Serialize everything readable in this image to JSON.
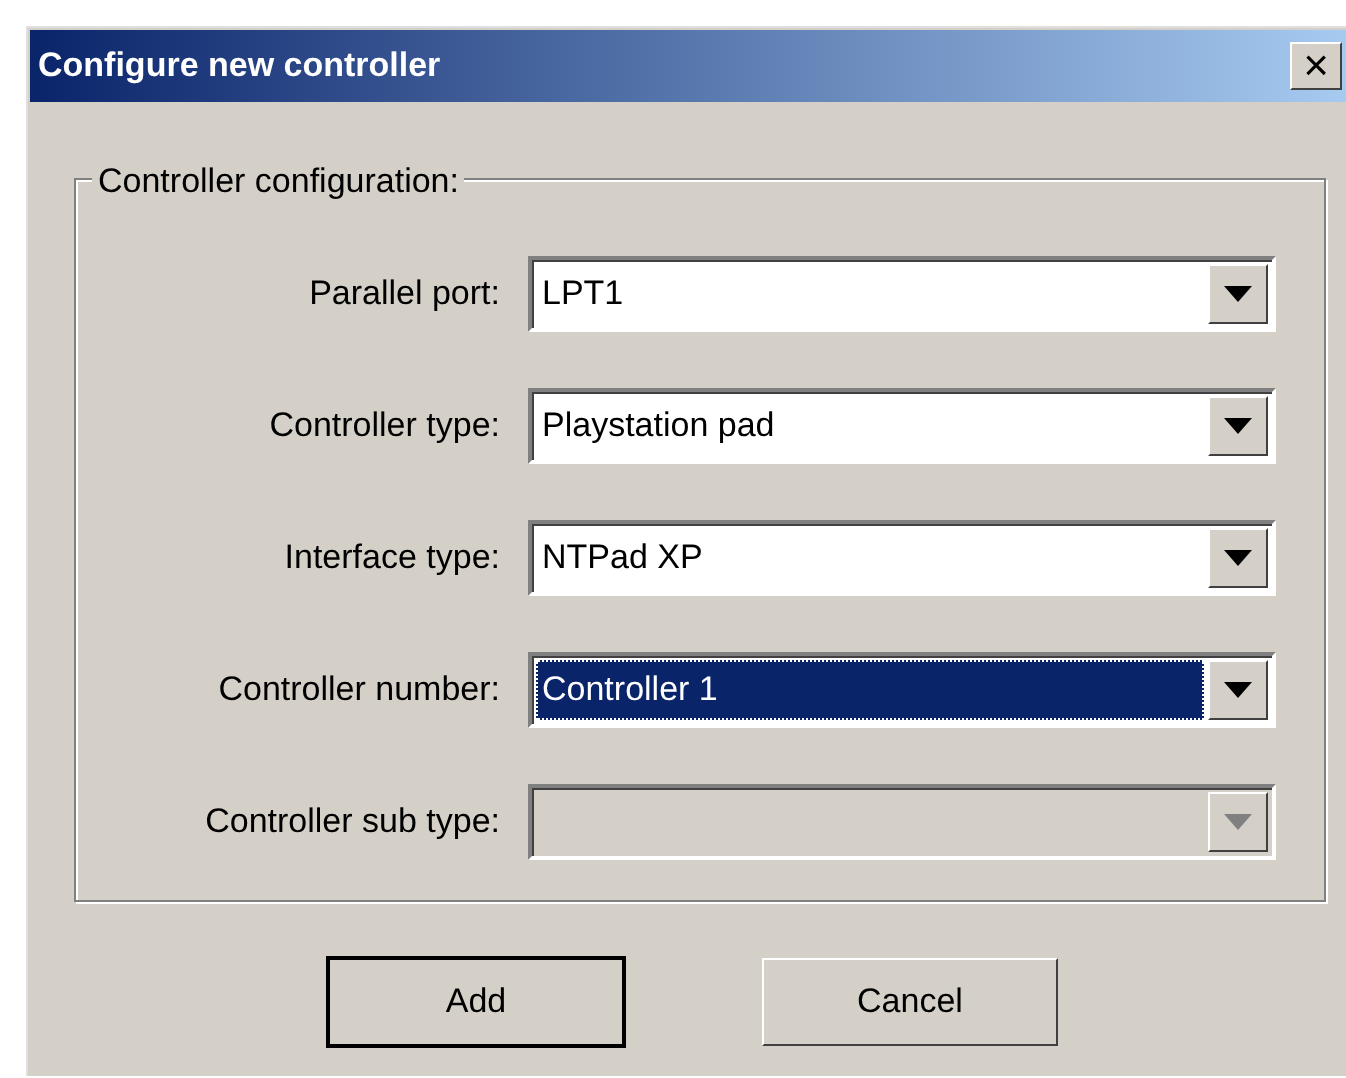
{
  "window": {
    "title": "Configure new controller",
    "close": "×"
  },
  "group": {
    "label": "Controller configuration:"
  },
  "fields": [
    {
      "label": "Parallel port:",
      "value": "LPT1",
      "selected": false,
      "disabled": false
    },
    {
      "label": "Controller type:",
      "value": "Playstation pad",
      "selected": false,
      "disabled": false
    },
    {
      "label": "Interface type:",
      "value": "NTPad XP",
      "selected": false,
      "disabled": false
    },
    {
      "label": "Controller number:",
      "value": "Controller 1",
      "selected": true,
      "disabled": false
    },
    {
      "label": "Controller sub type:",
      "selected": false,
      "disabled": true
    }
  ],
  "buttons": [
    {
      "label": "Add",
      "default": true
    },
    {
      "label": "Cancel",
      "default": false
    }
  ]
}
